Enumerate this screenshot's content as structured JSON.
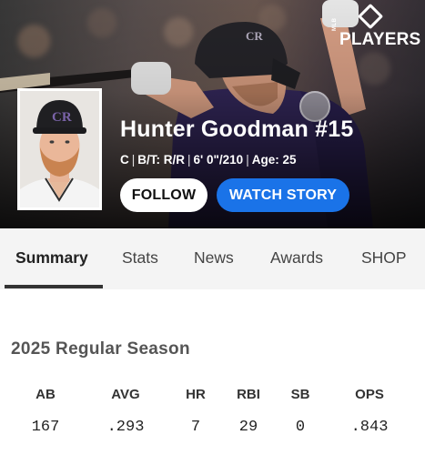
{
  "brand": {
    "logo_text": "PLAYERS",
    "logo_small_text": "MLB"
  },
  "player": {
    "name": "Hunter Goodman #15",
    "position": "C",
    "bats_throws": "B/T: R/R",
    "height_weight": "6' 0\"/210",
    "age": "Age: 25"
  },
  "actions": {
    "follow_label": "FOLLOW",
    "watch_label": "WATCH STORY"
  },
  "tabs": [
    {
      "label": "Summary",
      "active": true
    },
    {
      "label": "Stats"
    },
    {
      "label": "News"
    },
    {
      "label": "Awards"
    },
    {
      "label": "SHOP"
    }
  ],
  "season": {
    "title": "2025 Regular Season",
    "columns": [
      "AB",
      "AVG",
      "HR",
      "RBI",
      "SB",
      "OPS"
    ],
    "values": [
      "167",
      ".293",
      "7",
      "29",
      "0",
      ".843"
    ]
  },
  "colors": {
    "accent_blue": "#1a73e8",
    "team_purple": "#33275a"
  },
  "icons": {
    "hero_logo": "players-diamond-icon"
  }
}
